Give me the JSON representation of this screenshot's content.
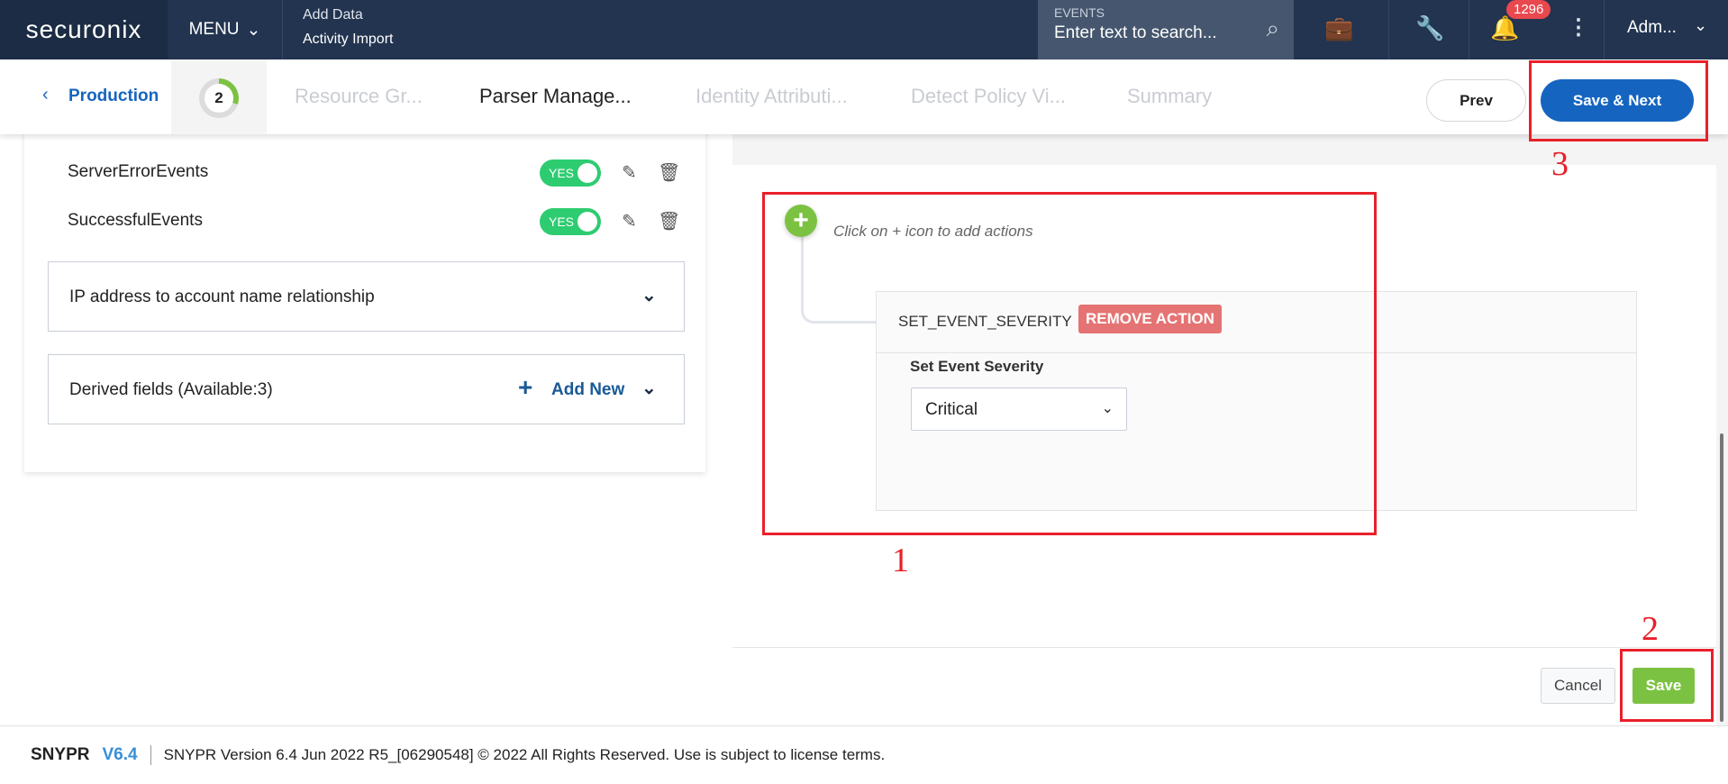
{
  "topbar": {
    "logo": "securonix",
    "menu": "MENU",
    "breadcrumb_top": "Add Data",
    "breadcrumb_bottom": "Activity Import",
    "search_label": "EVENTS",
    "search_placeholder": "Enter text to search...",
    "notification_count": "1296",
    "user": "Adm..."
  },
  "wizard": {
    "back": "Production",
    "step": "2",
    "tabs": [
      "Resource Gr...",
      "Parser Manage...",
      "Identity Attributi...",
      "Detect Policy Vi...",
      "Summary"
    ],
    "active_tab": "Parser Manage...",
    "prev": "Prev",
    "save_next": "Save & Next"
  },
  "left": {
    "rows": [
      {
        "name": "ServerErrorEvents",
        "toggle": "YES"
      },
      {
        "name": "SuccessfulEvents",
        "toggle": "YES"
      }
    ],
    "ip_section": "IP address to account name relationship",
    "derived_section": "Derived fields (Available:3)",
    "add_new": "Add New"
  },
  "actions": {
    "hint": "Click on + icon to add actions",
    "action_name": "SET_EVENT_SEVERITY",
    "remove": "REMOVE ACTION",
    "severity_label": "Set Event Severity",
    "severity_value": "Critical",
    "cancel": "Cancel",
    "save": "Save"
  },
  "annotations": [
    "1",
    "2",
    "3"
  ],
  "footer": {
    "product": "SNYPR",
    "version": "V6.4",
    "text": "SNYPR Version 6.4 Jun 2022 R5_[06290548] © 2022 All Rights Reserved. Use is subject to license terms."
  },
  "colors": {
    "header": "#22344f",
    "primary": "#1565c0",
    "toggle": "#2ecc71",
    "add": "#7cc242",
    "remove": "#e57373",
    "annotation": "#e8202a"
  }
}
